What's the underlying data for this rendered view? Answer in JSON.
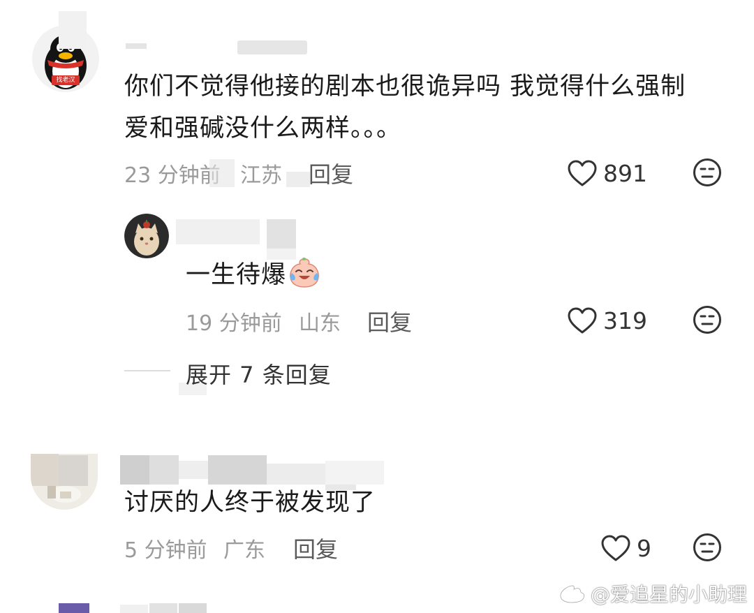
{
  "comments": [
    {
      "text_lines": [
        "你们不觉得他接的剧本也很诡异吗 我觉得什么强制",
        "爱和强碱没什么两样。。。"
      ],
      "time": "23 分钟前",
      "location": "江苏",
      "reply_label": "回复",
      "likes": "891",
      "avatar_badge": "找老汉"
    },
    {
      "text": "一生待爆",
      "time": "19 分钟前",
      "location": "山东",
      "reply_label": "回复",
      "likes": "319"
    },
    {
      "text": "讨厌的人终于被发现了",
      "time": "5 分钟前",
      "location": "广东",
      "reply_label": "回复",
      "likes": "9"
    }
  ],
  "expand_replies": "展开 7 条回复",
  "watermark": "@爱追星的小助理",
  "icons": {
    "like": "heart-outline-icon",
    "dislike": "neutral-face-icon",
    "emoji": "crying-laughing-peach-emoji",
    "weibo": "weibo-logo-icon"
  }
}
